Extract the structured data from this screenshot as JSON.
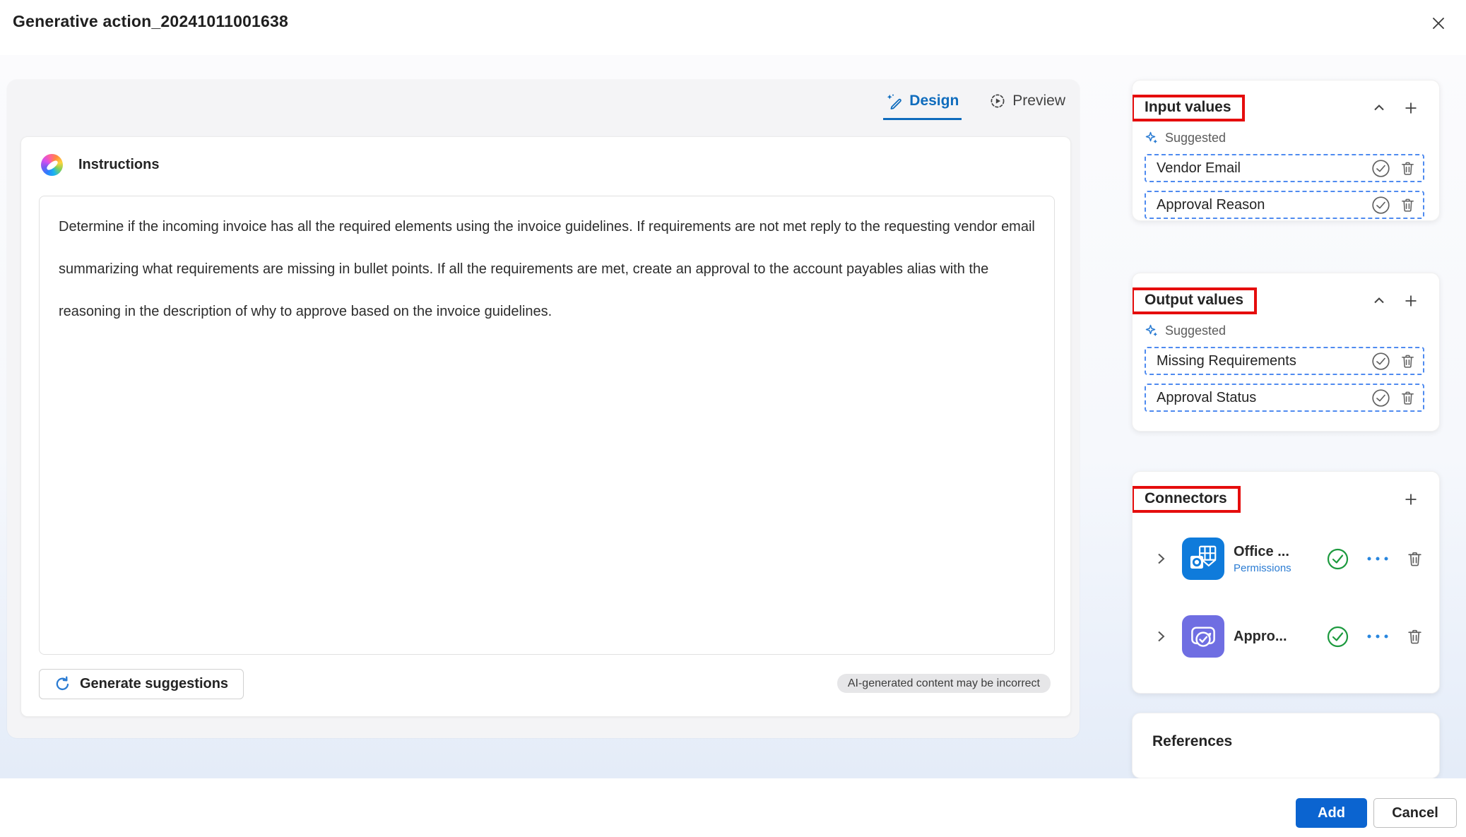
{
  "dialog": {
    "title": "Generative action_20241011001638"
  },
  "tabs": {
    "design": "Design",
    "preview": "Preview"
  },
  "instructions": {
    "heading": "Instructions",
    "text": "Determine if the incoming invoice has all the required elements using the invoice guidelines. If requirements are not met reply to the requesting vendor email summarizing what requirements are missing in bullet points. If all the requirements are met, create an approval to the account payables alias with the reasoning in the description of why to approve based on the invoice guidelines.",
    "generate_button": "Generate suggestions",
    "ai_notice": "AI-generated content may be incorrect"
  },
  "input_values": {
    "title": "Input values",
    "suggested": "Suggested",
    "items": [
      "Vendor Email",
      "Approval Reason"
    ]
  },
  "output_values": {
    "title": "Output values",
    "suggested": "Suggested",
    "items": [
      "Missing Requirements",
      "Approval Status"
    ]
  },
  "connectors": {
    "title": "Connectors",
    "items": [
      {
        "name": "Office ...",
        "link": "Permissions"
      },
      {
        "name": "Appro..."
      }
    ]
  },
  "references": {
    "title": "References"
  },
  "footer": {
    "add": "Add",
    "cancel": "Cancel"
  },
  "colors": {
    "accent_blue": "#0f6cbd",
    "add_button_blue": "#0b64d0",
    "annotation_red": "#e50d0d",
    "suggest_blue": "#2b7cd3",
    "dashed_border_blue": "#4f8bf0",
    "success_green": "#1d9a3f",
    "outlook_blue": "#0f7bdb",
    "approvals_purple": "#6f6ee2"
  }
}
